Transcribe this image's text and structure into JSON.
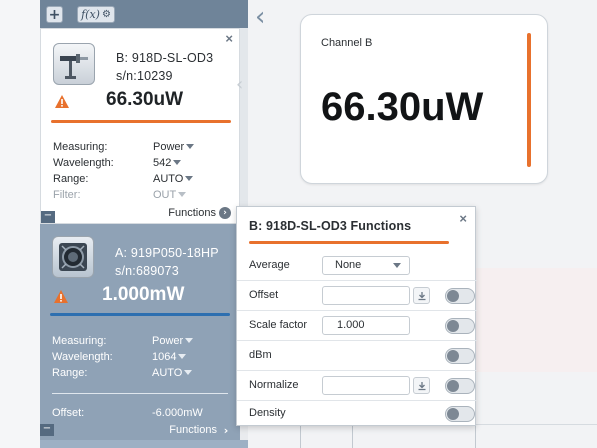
{
  "toolbar": {
    "add_label": "+",
    "fx_label": "f(x)",
    "fx_gear": "⚙"
  },
  "channel_b_card": {
    "model": "B: 918D-SL-OD3",
    "serial": "s/n:10239",
    "power": "66.30uW",
    "close": "×",
    "accent_color": "#e8712d",
    "icon": "sensor-detector-icon",
    "properties": [
      {
        "label": "Measuring:",
        "value": "Power"
      },
      {
        "label": "Wavelength:",
        "value": "542"
      },
      {
        "label": "Range:",
        "value": "AUTO"
      },
      {
        "label": "Filter:",
        "value": "OUT"
      }
    ],
    "functions_label": "Functions",
    "minus": "−"
  },
  "channel_a_card": {
    "model": "A: 919P050-18HP",
    "serial": "s/n:689073",
    "power": "1.000mW",
    "accent_color": "#2d6fb0",
    "icon": "thermopile-sensor-icon",
    "properties": [
      {
        "label": "Measuring:",
        "value": "Power"
      },
      {
        "label": "Wavelength:",
        "value": "1064"
      },
      {
        "label": "Range:",
        "value": "AUTO"
      }
    ],
    "offset_label": "Offset:",
    "offset_value": "-6.000mW",
    "functions_label": "Functions",
    "minus": "−"
  },
  "main": {
    "back_chevron": "‹",
    "channel_display": {
      "title": "Channel B",
      "value": "66.30uW"
    }
  },
  "functions_popup": {
    "title": "B: 918D-SL-OD3 Functions",
    "close": "×",
    "rows": [
      {
        "label": "Average",
        "control": "dropdown",
        "value": "None"
      },
      {
        "label": "Offset",
        "control": "input_toggle",
        "value": ""
      },
      {
        "label": "Scale factor",
        "control": "input_toggle",
        "value": "1.000"
      },
      {
        "label": "dBm",
        "control": "toggle"
      },
      {
        "label": "Normalize",
        "control": "input_toggle",
        "value": ""
      },
      {
        "label": "Density",
        "control": "toggle"
      }
    ]
  }
}
